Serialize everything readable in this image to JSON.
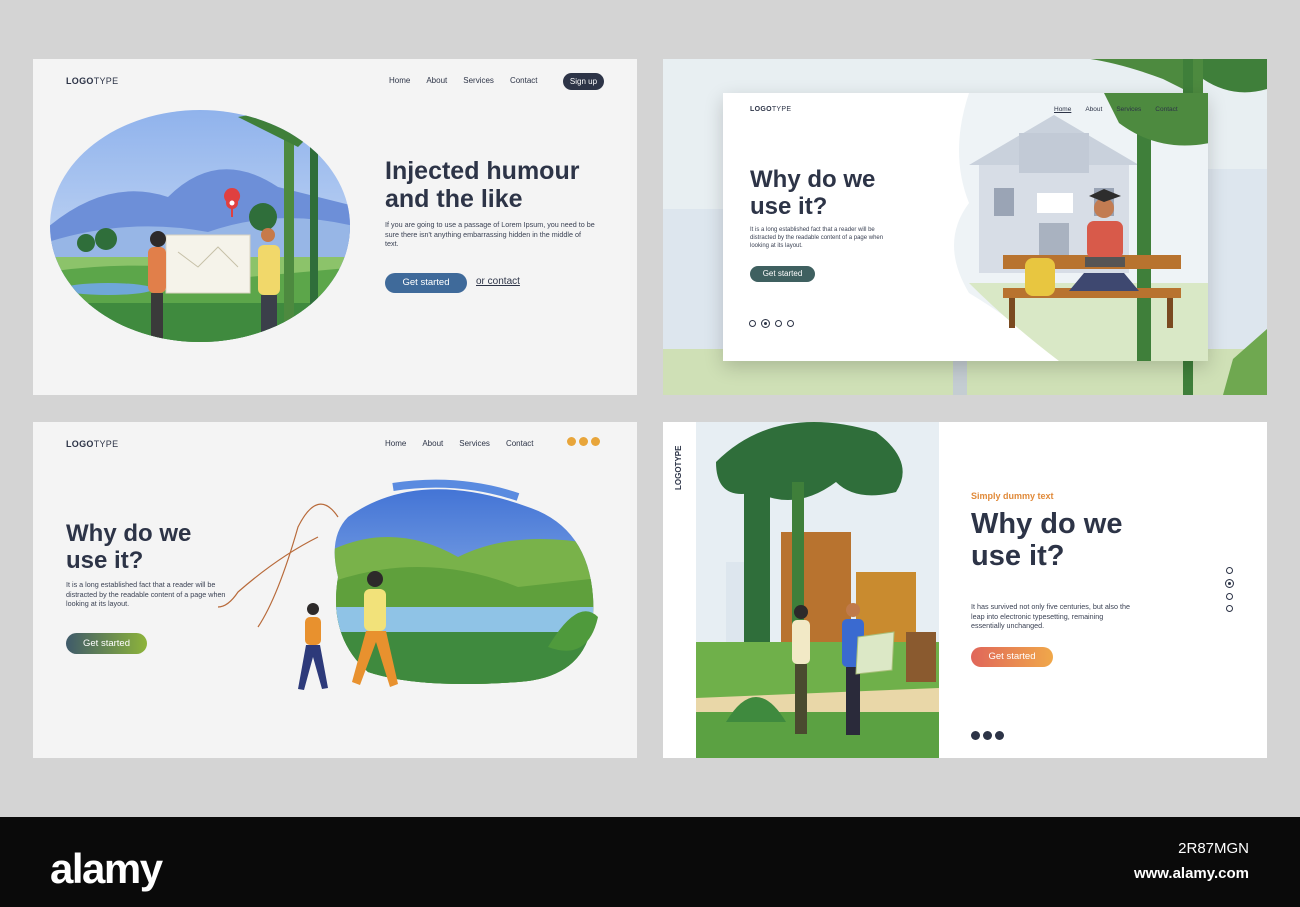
{
  "card1": {
    "logo_bold": "LOGO",
    "logo_thin": "TYPE",
    "nav": [
      "Home",
      "About",
      "Services",
      "Contact"
    ],
    "signup_label": "Sign up",
    "headline_line1": "Injected humour",
    "headline_line2": "and the like",
    "body": "If you are going to use a passage of Lorem Ipsum, you need to be sure there isn't anything embarrassing hidden in the middle of text.",
    "cta_label": "Get started",
    "secondary_link": "or contact",
    "icons": [
      "map-pin-icon"
    ]
  },
  "card2": {
    "logo_bold": "LOGO",
    "logo_thin": "TYPE",
    "nav": [
      "Home",
      "About",
      "Services",
      "Contact"
    ],
    "headline_line1": "Why do we",
    "headline_line2": "use it?",
    "body": "It is a long established fact that a reader will be distracted by the readable content of a page when looking at its layout.",
    "cta_label": "Get started",
    "carousel": {
      "total": 4,
      "active_index": 1
    }
  },
  "card3": {
    "logo_bold": "LOGO",
    "logo_thin": "TYPE",
    "nav": [
      "Home",
      "About",
      "Services",
      "Contact"
    ],
    "social_icons": [
      "mail-icon",
      "phone-icon",
      "send-icon"
    ],
    "headline_line1": "Why do we",
    "headline_line2": "use it?",
    "body": "It is a long established fact that a reader will be distracted by the readable content of a page when looking at its layout.",
    "cta_label": "Get started"
  },
  "card4": {
    "logo_vertical": "LOGOTYPE",
    "eyebrow": "Simply dummy text",
    "headline_line1": "Why do we",
    "headline_line2": "use it?",
    "body": "It has survived not only five centuries, but also the leap into electronic typesetting, remaining essentially unchanged.",
    "cta_label": "Get started",
    "carousel": {
      "total": 4,
      "active_index": 1
    },
    "social_icons": [
      "mail-icon",
      "phone-icon",
      "send-icon"
    ]
  },
  "footer": {
    "brand": "alamy",
    "image_id": "2R87MGN",
    "url": "www.alamy.com",
    "watermark": "alamy"
  },
  "colors": {
    "navy": "#2d3447",
    "card1_button": "#3f6a9a",
    "card2_button": "#3f6060",
    "card3_button_start": "#3f5a6a",
    "card3_button_end": "#8db43a",
    "card4_button_start": "#e0665a",
    "card4_button_end": "#f0a84a",
    "eyebrow": "#e08a3a"
  }
}
